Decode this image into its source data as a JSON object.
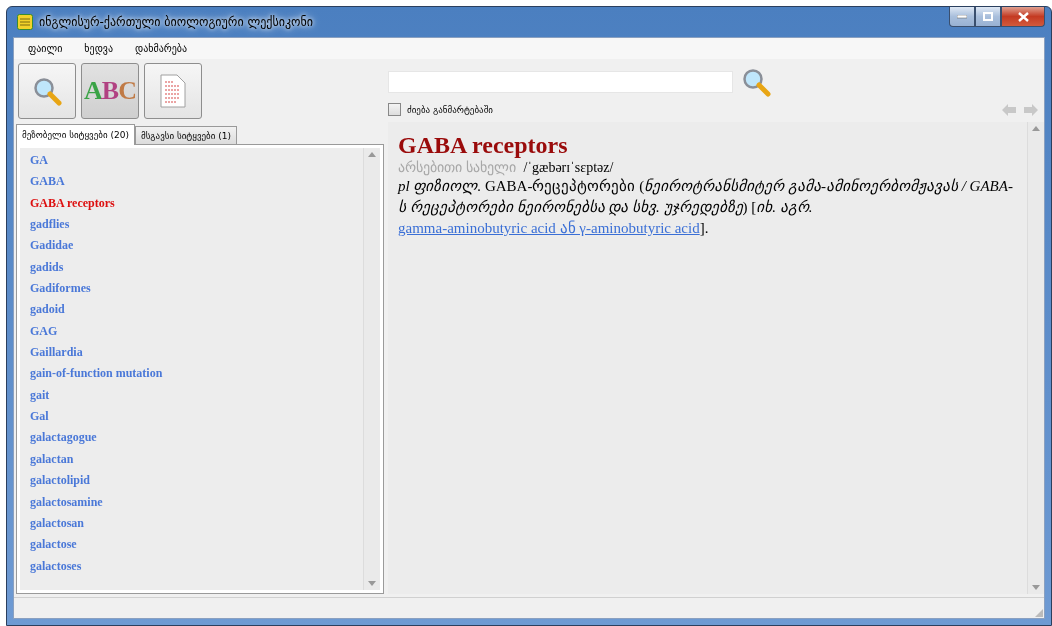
{
  "window": {
    "title": "ინგლისურ-ქართული ბიოლოგიური ლექსიკონი"
  },
  "menu": [
    "ფაილი",
    "ხედვა",
    "დახმარება"
  ],
  "toolbar": [
    {
      "kind": "search",
      "selected": false
    },
    {
      "kind": "abc",
      "label": "ABC",
      "selected": true
    },
    {
      "kind": "document",
      "selected": false
    }
  ],
  "search": {
    "checkbox": {
      "label": "ძიება განმარტებაში",
      "checked": false
    }
  },
  "tabs": [
    {
      "label": "მეზობელი სიტყვები (20)",
      "selected": true
    },
    {
      "label": "მსგავსი სიტყვები (1)",
      "selected": false
    }
  ],
  "words": [
    {
      "text": "GA",
      "selected": false
    },
    {
      "text": "GABA",
      "selected": false
    },
    {
      "text": "GABA receptors",
      "selected": true
    },
    {
      "text": "gadflies",
      "selected": false
    },
    {
      "text": "Gadidae",
      "selected": false
    },
    {
      "text": "gadids",
      "selected": false
    },
    {
      "text": "Gadiformes",
      "selected": false
    },
    {
      "text": "gadoid",
      "selected": false
    },
    {
      "text": "GAG",
      "selected": false
    },
    {
      "text": "Gaillardia",
      "selected": false
    },
    {
      "text": "gain-of-function mutation",
      "selected": false
    },
    {
      "text": "gait",
      "selected": false
    },
    {
      "text": "Gal",
      "selected": false
    },
    {
      "text": "galactagogue",
      "selected": false
    },
    {
      "text": "galactan",
      "selected": false
    },
    {
      "text": "galactolipid",
      "selected": false
    },
    {
      "text": "galactosamine",
      "selected": false
    },
    {
      "text": "galactosan",
      "selected": false
    },
    {
      "text": "galactose",
      "selected": false
    },
    {
      "text": "galactoses",
      "selected": false
    }
  ],
  "entry": {
    "headword": "GABA receptors",
    "part_of_speech": "არსებითი სახელი",
    "pronunciation": "/ˈgæbərɪˈsɛptəz/",
    "definition": {
      "before": "*pl ფიზიოლ.* GABA-რეცეპტორები (*ნეიროტრანსმიტერ გამა-ამინოერბომჟავას / GABA-ს რეცეპტორები ნეირონებსა და სხვ. უჯრედებზე*) [*იხ. აგრ.*",
      "link": "gamma-aminobutyric acid ან γ-aminobutyric acid",
      "after": "]."
    }
  },
  "navigation": {
    "back_disabled": true,
    "forward_disabled": true
  }
}
